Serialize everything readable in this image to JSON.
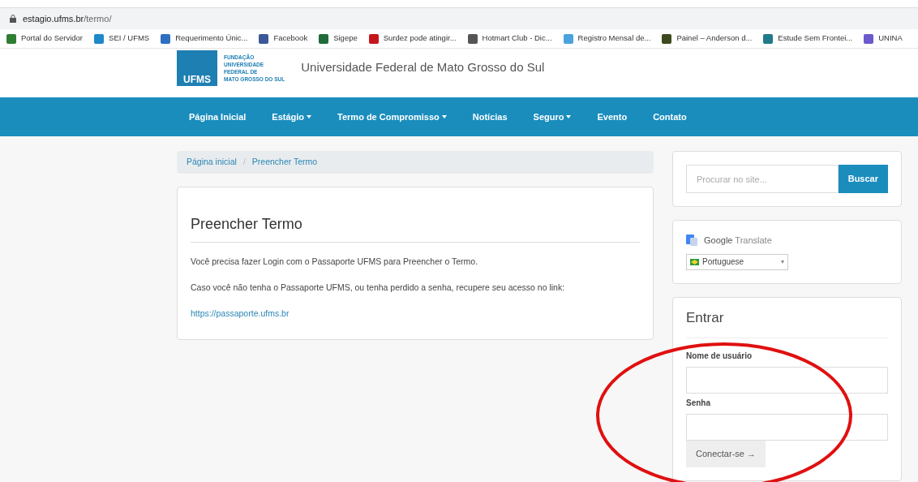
{
  "address_bar": {
    "url_host": "estagio.ufms.br",
    "url_path": "/termo/"
  },
  "bookmarks": [
    {
      "label": "Portal do Servidor",
      "color": "#2e7d32"
    },
    {
      "label": "SEI / UFMS",
      "color": "#1e88c8"
    },
    {
      "label": "Requerimento Únic...",
      "color": "#2f6fc0"
    },
    {
      "label": "Facebook",
      "color": "#3b5998"
    },
    {
      "label": "Sigepe",
      "color": "#1f6b3a"
    },
    {
      "label": "Surdez pode atingir...",
      "color": "#c4161c"
    },
    {
      "label": "Hotmart Club - Dic...",
      "color": "#555555"
    },
    {
      "label": "Registro Mensal de...",
      "color": "#4aa3df"
    },
    {
      "label": "Painel – Anderson d...",
      "color": "#3d4a1e"
    },
    {
      "label": "Estude Sem Frontei...",
      "color": "#1f7a8c"
    },
    {
      "label": "UNINA",
      "color": "#6a5acd"
    }
  ],
  "header": {
    "logo_text": "UFMS",
    "logo_lines": [
      "FUNDAÇÃO",
      "UNIVERSIDADE",
      "FEDERAL DE",
      "MATO GROSSO DO SUL"
    ],
    "title": "Universidade Federal de Mato Grosso do Sul"
  },
  "nav": [
    {
      "label": "Página Inicial",
      "has_menu": false
    },
    {
      "label": "Estágio",
      "has_menu": true
    },
    {
      "label": "Termo de Compromisso",
      "has_menu": true
    },
    {
      "label": "Notícias",
      "has_menu": false
    },
    {
      "label": "Seguro",
      "has_menu": true
    },
    {
      "label": "Evento",
      "has_menu": false
    },
    {
      "label": "Contato",
      "has_menu": false
    }
  ],
  "breadcrumb": [
    "Página inicial",
    "Preencher Termo"
  ],
  "breadcrumb_separator": "/",
  "content": {
    "title": "Preencher Termo",
    "paragraphs": [
      "Você precisa fazer Login com o Passaporte UFMS para Preencher o Termo.",
      "Caso você não tenha o Passaporte UFMS, ou tenha perdido a senha, recupere seu acesso no link:"
    ],
    "link": "https://passaporte.ufms.br"
  },
  "search": {
    "placeholder": "Procurar no site...",
    "button": "Buscar"
  },
  "translate": {
    "brand": "Google",
    "product": "Translate",
    "language": "Portuguese",
    "caret": "▾"
  },
  "login": {
    "title": "Entrar",
    "fields": [
      {
        "label": "Nome de usuário"
      },
      {
        "label": "Senha"
      }
    ],
    "button": "Conectar-se →"
  }
}
